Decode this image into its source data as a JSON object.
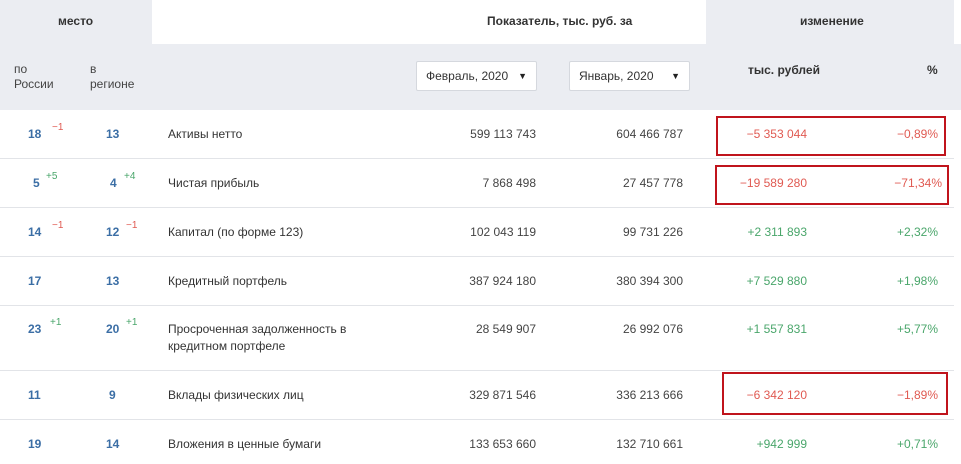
{
  "header": {
    "place": "место",
    "indicator": "Показатель, тыс. руб. за",
    "change": "изменение",
    "russia_line1": "по",
    "russia_line2": "России",
    "region_line1": "в",
    "region_line2": "регионе",
    "thousand_rub": "тыс. рублей",
    "percent": "%"
  },
  "selects": {
    "period_a": "Февраль, 2020",
    "period_b": "Январь, 2020"
  },
  "rows": [
    {
      "rank_russia": "18",
      "delta_russia": "−1",
      "rank_region": "13",
      "delta_region": "",
      "name_line1": "Активы нетто",
      "name_line2": "",
      "val_a": "599 113 743",
      "val_b": "604 466 787",
      "chg_abs": "−5 353 044",
      "chg_pct": "−0,89%"
    },
    {
      "rank_russia": "5",
      "delta_russia": "+5",
      "rank_region": "4",
      "delta_region": "+4",
      "name_line1": "Чистая прибыль",
      "name_line2": "",
      "val_a": "7 868 498",
      "val_b": "27 457 778",
      "chg_abs": "−19 589 280",
      "chg_pct": "−71,34%"
    },
    {
      "rank_russia": "14",
      "delta_russia": "−1",
      "rank_region": "12",
      "delta_region": "−1",
      "name_line1": "Капитал (по форме 123)",
      "name_line2": "",
      "val_a": "102 043 119",
      "val_b": "99 731 226",
      "chg_abs": "+2 311 893",
      "chg_pct": "+2,32%"
    },
    {
      "rank_russia": "17",
      "delta_russia": "",
      "rank_region": "13",
      "delta_region": "",
      "name_line1": "Кредитный портфель",
      "name_line2": "",
      "val_a": "387 924 180",
      "val_b": "380 394 300",
      "chg_abs": "+7 529 880",
      "chg_pct": "+1,98%"
    },
    {
      "rank_russia": "23",
      "delta_russia": "+1",
      "rank_region": "20",
      "delta_region": "+1",
      "name_line1": "Просроченная задолженность в",
      "name_line2": "кредитном портфеле",
      "val_a": "28 549 907",
      "val_b": "26 992 076",
      "chg_abs": "+1 557 831",
      "chg_pct": "+5,77%"
    },
    {
      "rank_russia": "11",
      "delta_russia": "",
      "rank_region": "9",
      "delta_region": "",
      "name_line1": "Вклады физических лиц",
      "name_line2": "",
      "val_a": "329 871 546",
      "val_b": "336 213 666",
      "chg_abs": "−6 342 120",
      "chg_pct": "−1,89%"
    },
    {
      "rank_russia": "19",
      "delta_russia": "",
      "rank_region": "14",
      "delta_region": "",
      "name_line1": "Вложения в ценные бумаги",
      "name_line2": "",
      "val_a": "133 653 660",
      "val_b": "132 710 661",
      "chg_abs": "+942 999",
      "chg_pct": "+0,71%"
    }
  ],
  "colors": {
    "negative": "#e05a52",
    "positive": "#4aa66b",
    "rank": "#3b6ea5",
    "highlight": "#c0141c"
  }
}
